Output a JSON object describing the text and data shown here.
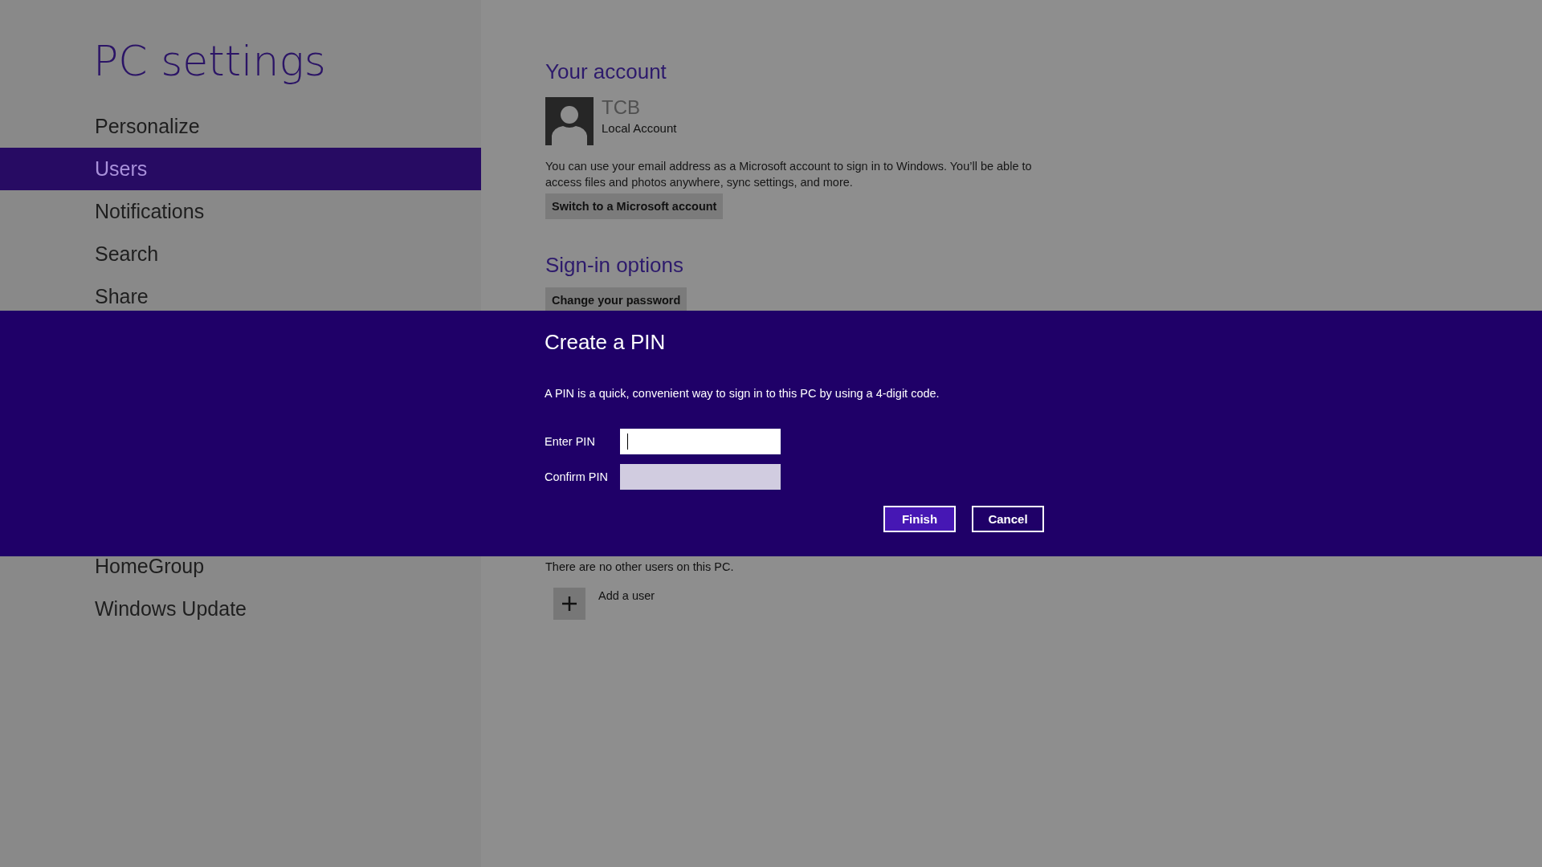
{
  "window": {
    "title": "PC settings"
  },
  "sidebar": {
    "items_top": [
      {
        "label": "Personalize",
        "selected": false
      },
      {
        "label": "Users",
        "selected": true
      },
      {
        "label": "Notifications",
        "selected": false
      },
      {
        "label": "Search",
        "selected": false
      },
      {
        "label": "Share",
        "selected": false
      }
    ],
    "items_bottom": [
      {
        "label": "HomeGroup",
        "selected": false
      },
      {
        "label": "Windows Update",
        "selected": false
      }
    ]
  },
  "account": {
    "heading": "Your account",
    "name": "TCB",
    "account_type": "Local Account",
    "description": "You can use your email address as a Microsoft account to sign in to Windows. You’ll be able to access files and photos anywhere, sync settings, and more.",
    "button": "Switch to a Microsoft account"
  },
  "sign_in_options": {
    "heading": "Sign-in options",
    "button": "Change your password"
  },
  "other_users": {
    "note": "There are no other users on this PC.",
    "add_label": "Add a user"
  },
  "dialog": {
    "title": "Create a PIN",
    "description": "A PIN is a quick, convenient way to sign in to this PC by using a 4-digit code.",
    "fields": [
      {
        "label": "Enter PIN",
        "focused": true
      },
      {
        "label": "Confirm PIN",
        "focused": false
      }
    ],
    "buttons": [
      {
        "label": "Finish",
        "default": true
      },
      {
        "label": "Cancel",
        "default": false
      }
    ]
  }
}
